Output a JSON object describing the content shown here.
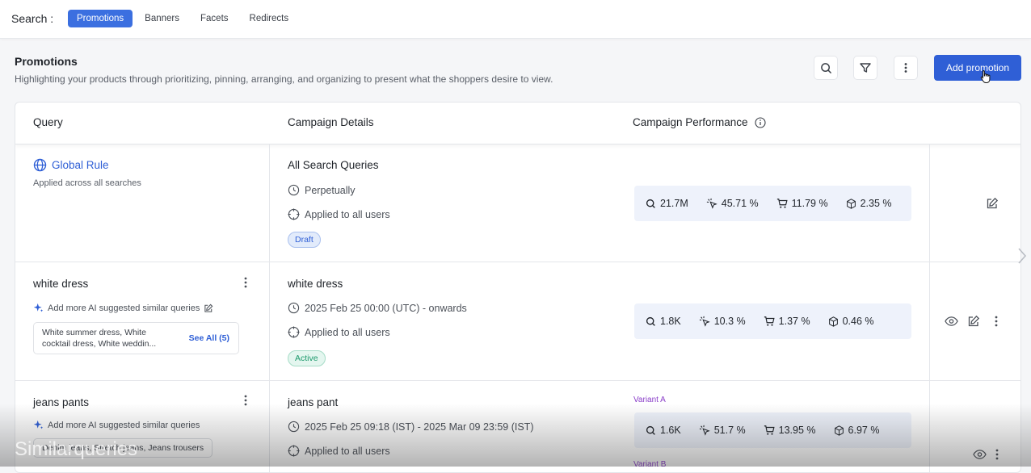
{
  "topbar": {
    "search_label": "Search :",
    "tabs": [
      {
        "label": "Promotions",
        "active": true
      },
      {
        "label": "Banners",
        "active": false
      },
      {
        "label": "Facets",
        "active": false
      },
      {
        "label": "Redirects",
        "active": false
      }
    ]
  },
  "header": {
    "title": "Promotions",
    "description": "Highlighting your products through prioritizing, pinning, arranging, and organizing to present what the shoppers desire to view.",
    "add_button": "Add promotion",
    "icons": [
      "search-icon",
      "filter-icon",
      "more-vertical-icon"
    ]
  },
  "table": {
    "columns": [
      "Query",
      "Campaign Details",
      "Campaign Performance"
    ],
    "rows": [
      {
        "query": "Global Rule",
        "query_sub": "Applied across all searches",
        "details_title": "All Search Queries",
        "schedule": "Perpetually",
        "audience": "Applied to all users",
        "status": "Draft",
        "perf": {
          "searches": "21.7M",
          "ctr": "45.71 %",
          "atc": "11.79 %",
          "conv": "2.35 %"
        }
      },
      {
        "query": "white dress",
        "ai_label": "Add more AI suggested similar queries",
        "suggestions": "White summer dress, White cocktail dress, White weddin...",
        "see_all": "See All (5)",
        "details_title": "white dress",
        "schedule": "2025 Feb 25 00:00 (UTC) - onwards",
        "audience": "Applied to all users",
        "status": "Active",
        "perf": {
          "searches": "1.8K",
          "ctr": "10.3 %",
          "atc": "1.37 %",
          "conv": "0.46 %"
        }
      },
      {
        "query": "jeans pants",
        "ai_label": "Add more AI suggested similar queries",
        "suggestions": "Denim jeans, Stretch jeans, Jeans trousers",
        "details_title": "jeans pant",
        "schedule": "2025 Feb 25 09:18 (IST) - 2025 Mar 09 23:59 (IST)",
        "audience": "Applied to all users",
        "variant_a": "Variant A",
        "variant_b": "Variant B",
        "perf": {
          "searches": "1.6K",
          "ctr": "51.7 %",
          "atc": "13.95 %",
          "conv": "6.97 %"
        }
      }
    ]
  },
  "watermark": "Similarqueries",
  "colors": {
    "primary": "#2f5fd6",
    "active": "#1d9a6c",
    "variant": "#8a3ec9"
  }
}
